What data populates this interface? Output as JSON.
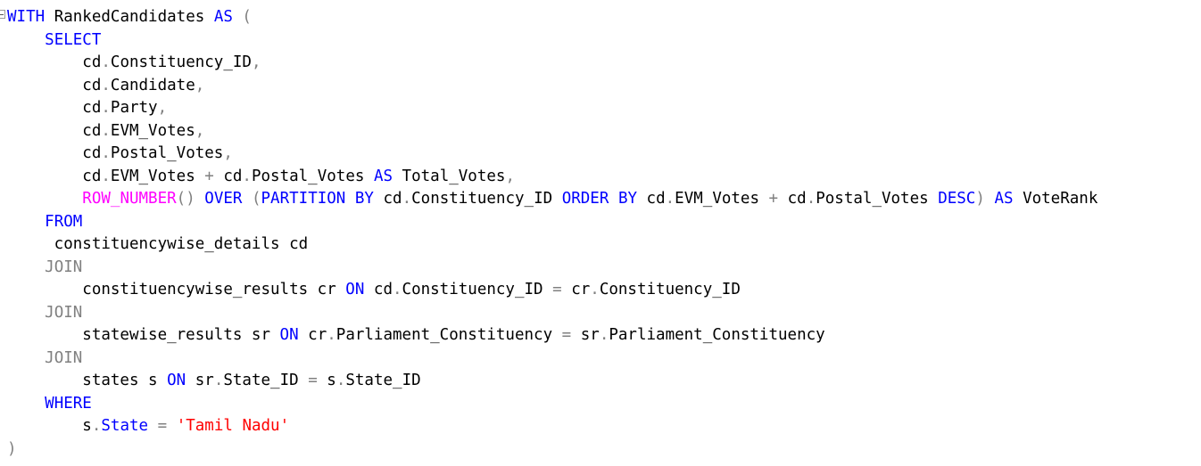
{
  "editor": {
    "colors": {
      "keyword": "#0000ff",
      "function": "#ff00ff",
      "operator": "#808080",
      "string": "#ff0000",
      "identifier": "#000000",
      "background": "#ffffff"
    },
    "lines": [
      [
        {
          "t": "WITH",
          "c": "kw"
        },
        {
          "t": " RankedCandidates ",
          "c": "id"
        },
        {
          "t": "AS",
          "c": "kw"
        },
        {
          "t": " (",
          "c": "op"
        }
      ],
      [
        {
          "t": "    ",
          "c": "id"
        },
        {
          "t": "SELECT",
          "c": "kw"
        }
      ],
      [
        {
          "t": "        cd",
          "c": "id"
        },
        {
          "t": ".",
          "c": "op"
        },
        {
          "t": "Constituency_ID",
          "c": "id"
        },
        {
          "t": ",",
          "c": "op"
        }
      ],
      [
        {
          "t": "        cd",
          "c": "id"
        },
        {
          "t": ".",
          "c": "op"
        },
        {
          "t": "Candidate",
          "c": "id"
        },
        {
          "t": ",",
          "c": "op"
        }
      ],
      [
        {
          "t": "        cd",
          "c": "id"
        },
        {
          "t": ".",
          "c": "op"
        },
        {
          "t": "Party",
          "c": "id"
        },
        {
          "t": ",",
          "c": "op"
        }
      ],
      [
        {
          "t": "        cd",
          "c": "id"
        },
        {
          "t": ".",
          "c": "op"
        },
        {
          "t": "EVM_Votes",
          "c": "id"
        },
        {
          "t": ",",
          "c": "op"
        }
      ],
      [
        {
          "t": "        cd",
          "c": "id"
        },
        {
          "t": ".",
          "c": "op"
        },
        {
          "t": "Postal_Votes",
          "c": "id"
        },
        {
          "t": ",",
          "c": "op"
        }
      ],
      [
        {
          "t": "        cd",
          "c": "id"
        },
        {
          "t": ".",
          "c": "op"
        },
        {
          "t": "EVM_Votes ",
          "c": "id"
        },
        {
          "t": "+",
          "c": "op"
        },
        {
          "t": " cd",
          "c": "id"
        },
        {
          "t": ".",
          "c": "op"
        },
        {
          "t": "Postal_Votes ",
          "c": "id"
        },
        {
          "t": "AS",
          "c": "kw"
        },
        {
          "t": " Total_Votes",
          "c": "id"
        },
        {
          "t": ",",
          "c": "op"
        }
      ],
      [
        {
          "t": "        ",
          "c": "id"
        },
        {
          "t": "ROW_NUMBER",
          "c": "fn"
        },
        {
          "t": "()",
          "c": "op"
        },
        {
          "t": " ",
          "c": "id"
        },
        {
          "t": "OVER",
          "c": "kw"
        },
        {
          "t": " (",
          "c": "op"
        },
        {
          "t": "PARTITION",
          "c": "kw"
        },
        {
          "t": " ",
          "c": "id"
        },
        {
          "t": "BY",
          "c": "kw"
        },
        {
          "t": " cd",
          "c": "id"
        },
        {
          "t": ".",
          "c": "op"
        },
        {
          "t": "Constituency_ID ",
          "c": "id"
        },
        {
          "t": "ORDER",
          "c": "kw"
        },
        {
          "t": " ",
          "c": "id"
        },
        {
          "t": "BY",
          "c": "kw"
        },
        {
          "t": " cd",
          "c": "id"
        },
        {
          "t": ".",
          "c": "op"
        },
        {
          "t": "EVM_Votes ",
          "c": "id"
        },
        {
          "t": "+",
          "c": "op"
        },
        {
          "t": " cd",
          "c": "id"
        },
        {
          "t": ".",
          "c": "op"
        },
        {
          "t": "Postal_Votes ",
          "c": "id"
        },
        {
          "t": "DESC",
          "c": "kw"
        },
        {
          "t": ")",
          "c": "op"
        },
        {
          "t": " ",
          "c": "id"
        },
        {
          "t": "AS",
          "c": "kw"
        },
        {
          "t": " VoteRank",
          "c": "id"
        }
      ],
      [
        {
          "t": "    ",
          "c": "id"
        },
        {
          "t": "FROM",
          "c": "kw"
        }
      ],
      [
        {
          "t": "     constituencywise_details cd",
          "c": "id"
        }
      ],
      [
        {
          "t": "    ",
          "c": "id"
        },
        {
          "t": "JOIN",
          "c": "op"
        }
      ],
      [
        {
          "t": "        constituencywise_results cr ",
          "c": "id"
        },
        {
          "t": "ON",
          "c": "kw"
        },
        {
          "t": " cd",
          "c": "id"
        },
        {
          "t": ".",
          "c": "op"
        },
        {
          "t": "Constituency_ID ",
          "c": "id"
        },
        {
          "t": "=",
          "c": "op"
        },
        {
          "t": " cr",
          "c": "id"
        },
        {
          "t": ".",
          "c": "op"
        },
        {
          "t": "Constituency_ID",
          "c": "id"
        }
      ],
      [
        {
          "t": "    ",
          "c": "id"
        },
        {
          "t": "JOIN",
          "c": "op"
        }
      ],
      [
        {
          "t": "        statewise_results sr ",
          "c": "id"
        },
        {
          "t": "ON",
          "c": "kw"
        },
        {
          "t": " cr",
          "c": "id"
        },
        {
          "t": ".",
          "c": "op"
        },
        {
          "t": "Parliament_Constituency ",
          "c": "id"
        },
        {
          "t": "=",
          "c": "op"
        },
        {
          "t": " sr",
          "c": "id"
        },
        {
          "t": ".",
          "c": "op"
        },
        {
          "t": "Parliament_Constituency",
          "c": "id"
        }
      ],
      [
        {
          "t": "    ",
          "c": "id"
        },
        {
          "t": "JOIN",
          "c": "op"
        }
      ],
      [
        {
          "t": "        states s ",
          "c": "id"
        },
        {
          "t": "ON",
          "c": "kw"
        },
        {
          "t": " sr",
          "c": "id"
        },
        {
          "t": ".",
          "c": "op"
        },
        {
          "t": "State_ID ",
          "c": "id"
        },
        {
          "t": "=",
          "c": "op"
        },
        {
          "t": " s",
          "c": "id"
        },
        {
          "t": ".",
          "c": "op"
        },
        {
          "t": "State_ID",
          "c": "id"
        }
      ],
      [
        {
          "t": "    ",
          "c": "id"
        },
        {
          "t": "WHERE",
          "c": "kw"
        }
      ],
      [
        {
          "t": "        s",
          "c": "id"
        },
        {
          "t": ".",
          "c": "op"
        },
        {
          "t": "State",
          "c": "kw"
        },
        {
          "t": " ",
          "c": "id"
        },
        {
          "t": "=",
          "c": "op"
        },
        {
          "t": " ",
          "c": "id"
        },
        {
          "t": "'Tamil Nadu'",
          "c": "str"
        }
      ],
      [
        {
          "t": ")",
          "c": "op"
        }
      ]
    ]
  }
}
